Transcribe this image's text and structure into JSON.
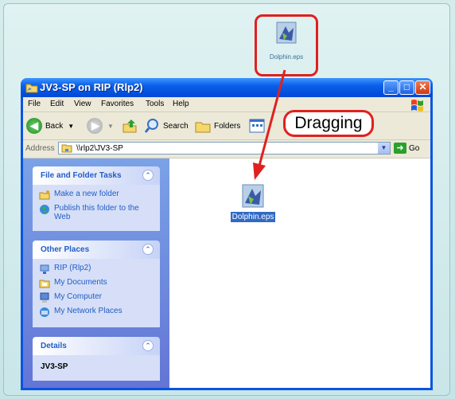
{
  "desktop": {
    "icon_label": "Dolphin.eps"
  },
  "window": {
    "title": "JV3-SP on RIP (Rlp2)",
    "controls": {
      "minimize": "_",
      "maximize": "□",
      "close": "✕"
    }
  },
  "menubar": [
    "File",
    "Edit",
    "View",
    "Favorites",
    "Tools",
    "Help"
  ],
  "toolbar": {
    "back": "Back",
    "search": "Search",
    "folders": "Folders"
  },
  "address": {
    "label": "Address",
    "value": "\\\\rlp2\\JV3-SP",
    "go": "Go"
  },
  "panels": {
    "tasks": {
      "title": "File and Folder Tasks",
      "items": [
        "Make a new folder",
        "Publish this folder to the Web"
      ]
    },
    "places": {
      "title": "Other Places",
      "items": [
        "RIP (Rlp2)",
        "My Documents",
        "My Computer",
        "My Network Places"
      ]
    },
    "details": {
      "title": "Details",
      "value": "JV3-SP"
    }
  },
  "file": {
    "label": "Dolphin.eps"
  },
  "callout": {
    "text": "Dragging"
  },
  "colors": {
    "highlight": "#e02020",
    "xp_blue": "#0a54e0",
    "link": "#215dc6"
  }
}
